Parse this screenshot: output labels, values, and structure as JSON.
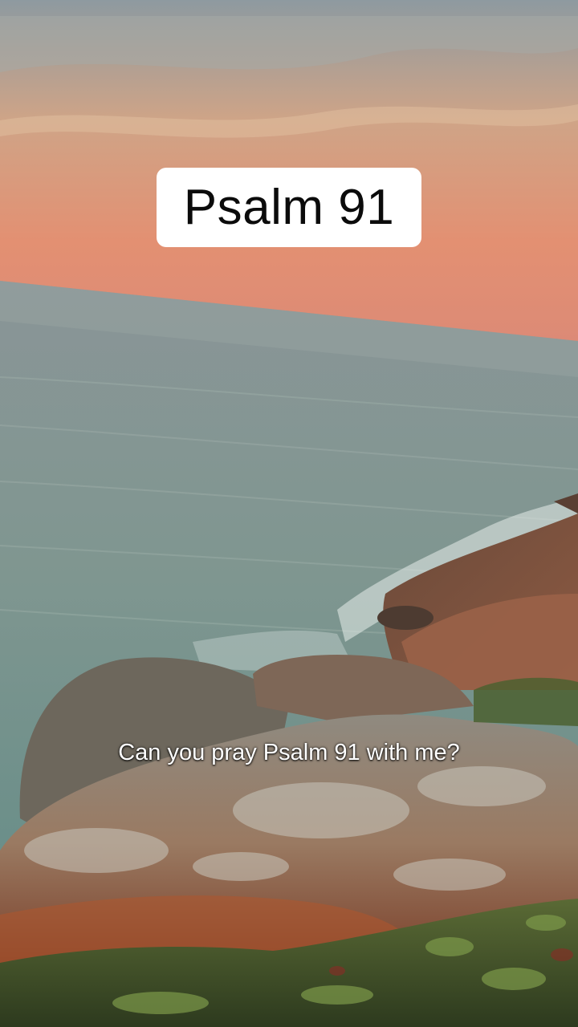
{
  "video": {
    "title": "Psalm 91",
    "caption": "Can you pray Psalm 91 with me?"
  },
  "scene": {
    "description_colors": {
      "sky_top": "#8c9aa2",
      "sky_mid": "#d9a07d",
      "sky_horizon": "#e0876a",
      "sea_far": "#7c8e90",
      "sea_near": "#5d8a86",
      "rock": "#7a7468",
      "rock_warm": "#8a4d35",
      "grass": "#3e5a2a"
    }
  }
}
